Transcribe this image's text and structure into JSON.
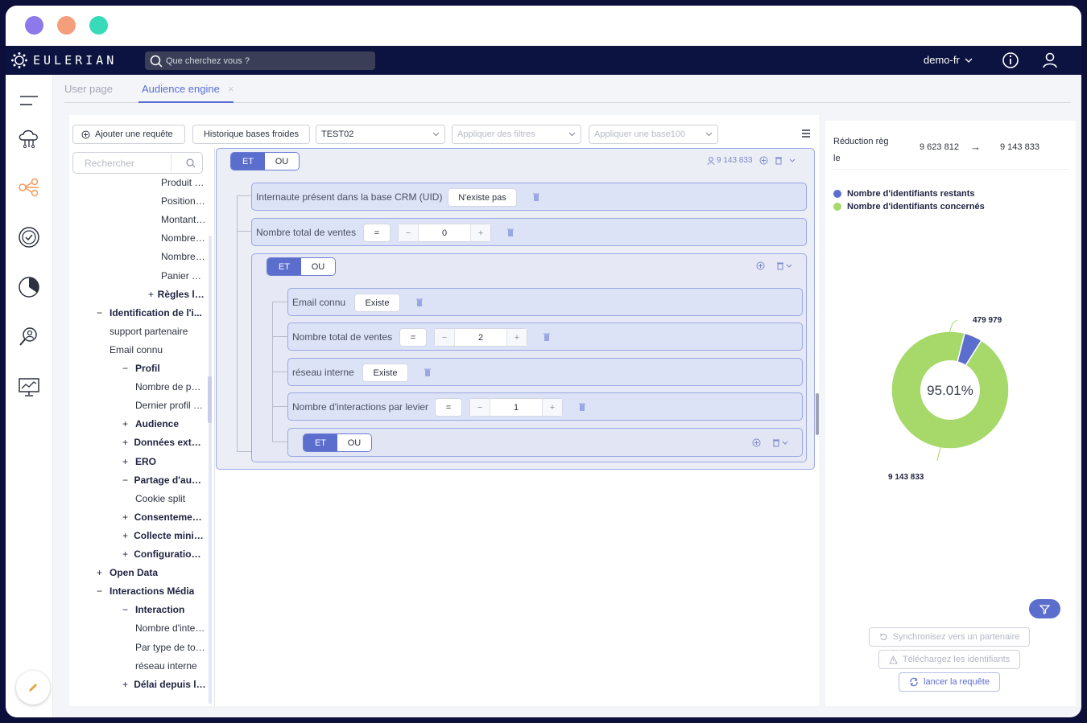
{
  "window_controls": {
    "colors": [
      "#8e79ea",
      "#f49e7b",
      "#38dbb9"
    ]
  },
  "topbar": {
    "brand": "EULERIAN",
    "search_placeholder": "Que cherchez vous ?",
    "account": "demo-fr"
  },
  "tabs": [
    {
      "label": "User page"
    },
    {
      "label": "Audience engine",
      "close": "×"
    }
  ],
  "toolbar": {
    "add_request": "Ajouter une requête",
    "history": "Historique bases froides",
    "base_select": "TEST02",
    "filters_placeholder": "Appliquer des filtres",
    "base100_placeholder": "Appliquer une base100"
  },
  "tree": {
    "search_placeholder": "Rechercher",
    "items": [
      {
        "label": "Produit ache...",
        "sym": "",
        "indent": 3,
        "bold": false
      },
      {
        "label": "Position de l...",
        "sym": "",
        "indent": 3,
        "bold": false
      },
      {
        "label": "Montant total...",
        "sym": "",
        "indent": 3,
        "bold": false
      },
      {
        "label": "Nombre de j...",
        "sym": "",
        "indent": 3,
        "bold": false
      },
      {
        "label": "Nombre total...",
        "sym": "",
        "indent": 3,
        "bold": false
      },
      {
        "label": "Panier moye...",
        "sym": "",
        "indent": 3,
        "bold": false
      },
      {
        "label": "Règles liées ...",
        "sym": "+",
        "indent": 2.5,
        "bold": true
      },
      {
        "label": "Identification de l'i...",
        "sym": "−",
        "indent": 0.5,
        "bold": true
      },
      {
        "label": "support partenaire",
        "sym": "",
        "indent": 1,
        "bold": false
      },
      {
        "label": "Email connu",
        "sym": "",
        "indent": 1,
        "bold": false
      },
      {
        "label": "Profil",
        "sym": "−",
        "indent": 1.5,
        "bold": true
      },
      {
        "label": "Nombre de pag...",
        "sym": "",
        "indent": 2,
        "bold": false
      },
      {
        "label": "Dernier profil ac...",
        "sym": "",
        "indent": 2,
        "bold": false
      },
      {
        "label": "Audience",
        "sym": "+",
        "indent": 1.5,
        "bold": true
      },
      {
        "label": "Données extern...",
        "sym": "+",
        "indent": 1.5,
        "bold": true
      },
      {
        "label": "ERO",
        "sym": "+",
        "indent": 1.5,
        "bold": true
      },
      {
        "label": "Partage d'audie...",
        "sym": "−",
        "indent": 1.5,
        "bold": true
      },
      {
        "label": "Cookie split",
        "sym": "",
        "indent": 2,
        "bold": false
      },
      {
        "label": "Consentement ...",
        "sym": "+",
        "indent": 1.5,
        "bold": true
      },
      {
        "label": "Collecte minimale",
        "sym": "+",
        "indent": 1.5,
        "bold": true
      },
      {
        "label": "Configuration U...",
        "sym": "+",
        "indent": 1.5,
        "bold": true
      },
      {
        "label": "Open Data",
        "sym": "+",
        "indent": 0.5,
        "bold": true
      },
      {
        "label": "Interactions Média",
        "sym": "−",
        "indent": 0.5,
        "bold": true
      },
      {
        "label": "Interaction",
        "sym": "−",
        "indent": 1.5,
        "bold": true
      },
      {
        "label": "Nombre d'intera...",
        "sym": "",
        "indent": 2,
        "bold": false
      },
      {
        "label": "Par type de tou...",
        "sym": "",
        "indent": 2,
        "bold": false
      },
      {
        "label": "réseau interne",
        "sym": "",
        "indent": 2,
        "bold": false
      },
      {
        "label": "Délai depuis l'in...",
        "sym": "+",
        "indent": 1.5,
        "bold": true
      }
    ]
  },
  "builder": {
    "root": {
      "et": "ET",
      "ou": "OU",
      "count": "9 143 833"
    },
    "conditions": {
      "crm": {
        "label": "Internaute présent dans la base CRM (UID)",
        "value": "N'existe pas"
      },
      "ventes": {
        "label": "Nombre total de ventes",
        "op": "=",
        "minus": "−",
        "value": "0",
        "plus": "+"
      },
      "email": {
        "label": "Email connu",
        "value": "Existe"
      },
      "ventes2": {
        "label": "Nombre total de ventes",
        "op": "=",
        "minus": "−",
        "value": "2",
        "plus": "+"
      },
      "reseau": {
        "label": "réseau interne",
        "value": "Existe"
      },
      "interactions": {
        "label": "Nombre d'interactions par levier",
        "op": "=",
        "minus": "−",
        "value": "1",
        "plus": "+"
      }
    },
    "group2": {
      "et": "ET",
      "ou": "OU"
    },
    "group3": {
      "et": "ET",
      "ou": "OU"
    }
  },
  "right": {
    "reduction_label_1": "Réduction règ",
    "reduction_label_2": "le",
    "from": "9 623 812",
    "arrow": "→",
    "to": "9 143 833",
    "legend": [
      {
        "label": "Nombre d'identifiants restants",
        "color": "#5b6dcd"
      },
      {
        "label": "Nombre d'identifiants concernés",
        "color": "#a6d96a"
      }
    ],
    "chart": {
      "type": "pie",
      "values": [
        479979,
        9143833
      ],
      "colors": [
        "#5b6dcd",
        "#a6d96a"
      ],
      "center_label": "95.01%",
      "label_small": "479 979",
      "label_large": "9 143 833"
    },
    "actions": {
      "sync": "Synchronisez vers un partenaire",
      "download": "Téléchargez les identifiants",
      "launch": "lancer la requête"
    }
  }
}
